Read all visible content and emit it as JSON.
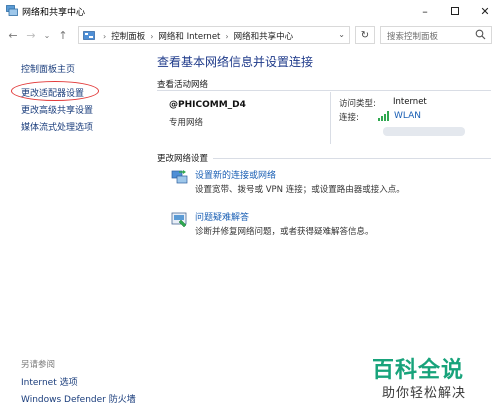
{
  "window": {
    "title": "网络和共享中心",
    "controls": [
      "minimize",
      "maximize",
      "close"
    ]
  },
  "address_bar": {
    "crumbs": [
      "控制面板",
      "网络和 Internet",
      "网络和共享中心"
    ],
    "search_placeholder": "搜索控制面板"
  },
  "sidebar": {
    "items": [
      {
        "label": "控制面板主页"
      },
      {
        "label": "更改适配器设置"
      },
      {
        "label": "更改高级共享设置"
      },
      {
        "label": "媒体流式处理选项"
      }
    ],
    "see_also_title": "另请参阅",
    "see_also": [
      {
        "label": "Internet 选项"
      },
      {
        "label": "Windows Defender 防火墙"
      }
    ]
  },
  "main": {
    "heading": "查看基本网络信息并设置连接",
    "active_networks_label": "查看活动网络",
    "network": {
      "name": "@PHICOMM_D4",
      "type": "专用网络",
      "access_type_label": "访问类型:",
      "access_type_value": "Internet",
      "connections_label": "连接:",
      "connection_value": "WLAN"
    },
    "change_settings_label": "更改网络设置",
    "tasks": [
      {
        "link": "设置新的连接或网络",
        "desc": "设置宽带、拨号或 VPN 连接；或设置路由器或接入点。"
      },
      {
        "link": "问题疑难解答",
        "desc": "诊断并修复网络问题，或者获得疑难解答信息。"
      }
    ]
  },
  "watermark": {
    "logo": "百科全说",
    "sub": "助你轻松解决"
  },
  "colors": {
    "link": "#1a3d7c",
    "heading": "#1e3a8a",
    "highlight_circle": "#e23a3a",
    "watermark": "#18a37b"
  }
}
